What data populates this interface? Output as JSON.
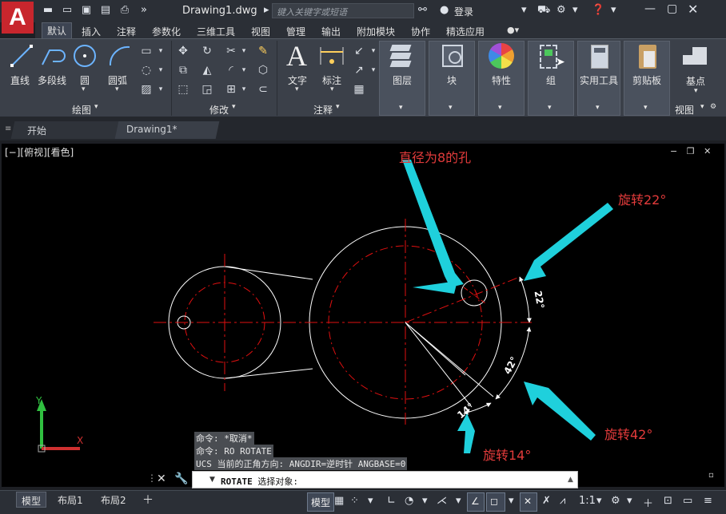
{
  "window": {
    "title": "Drawing1.dwg",
    "search_placeholder": "键入关键字或短语",
    "login_label": "登录"
  },
  "ribbon_tabs": [
    "默认",
    "插入",
    "注释",
    "参数化",
    "三维工具",
    "视图",
    "管理",
    "输出",
    "附加模块",
    "协作",
    "精选应用"
  ],
  "ribbon": {
    "draw": {
      "title": "绘图",
      "line": "直线",
      "polyline": "多段线",
      "circle": "圆",
      "arc": "圆弧"
    },
    "modify": {
      "title": "修改"
    },
    "annotation": {
      "title": "注释",
      "text": "文字",
      "dimension": "标注"
    },
    "layers": "图层",
    "block": "块",
    "properties": "特性",
    "groups": "组",
    "utilities": "实用工具",
    "clipboard": "剪贴板",
    "view": {
      "basepoint": "基点",
      "title": "视图"
    }
  },
  "doc_tabs": {
    "start": "开始",
    "drawing": "Drawing1*"
  },
  "viewport": {
    "label": "[−][俯视][看色]"
  },
  "drawing": {
    "dim_22": "22°",
    "dim_42": "42°",
    "dim_14": "14°",
    "colors": {
      "geometry": "#ffffff",
      "centerline": "#e01010",
      "arrow": "#1fd0dc"
    }
  },
  "annotations": {
    "hole": "直径为8的孔",
    "rotate22": "旋转22°",
    "rotate42": "旋转42°",
    "rotate14": "旋转14°"
  },
  "command_history": [
    "命令: *取消*",
    "命令: RO ROTATE",
    "UCS 当前的正角方向:  ANGDIR=逆时针  ANGBASE=0"
  ],
  "command_input": {
    "command": "ROTATE",
    "prompt": "选择对象:"
  },
  "layout_tabs": [
    "模型",
    "布局1",
    "布局2"
  ],
  "statusbar": {
    "model": "模型",
    "scale": "1:1"
  }
}
